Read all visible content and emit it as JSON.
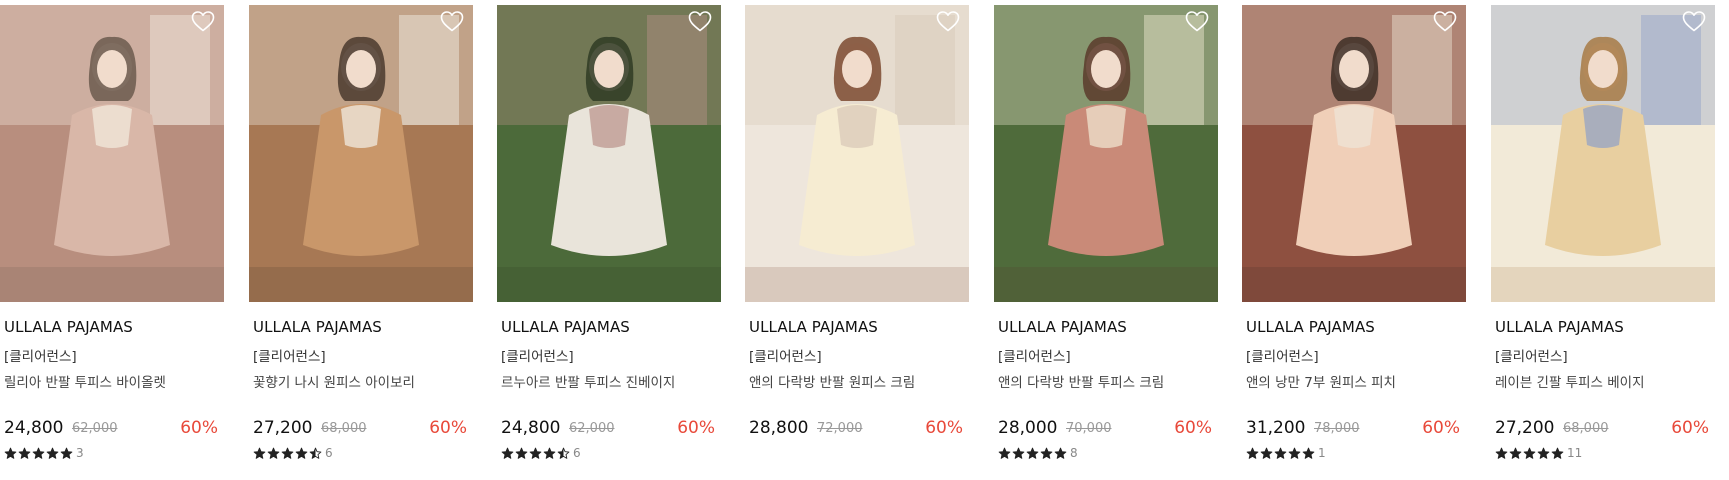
{
  "products": [
    {
      "brand": "ULLALA PAJAMAS",
      "tag": "[클리어런스]",
      "name": "릴리아 반팔 투피스 바이올렛",
      "price": "24,800",
      "original_price": "62,000",
      "discount": "60%",
      "rating": 5,
      "review_count": "3",
      "palette": [
        "#b88e7e",
        "#d9b7a8",
        "#f4ece0",
        "#6b5a4e"
      ]
    },
    {
      "brand": "ULLALA PAJAMAS",
      "tag": "[클리어런스]",
      "name": "꽃향기 나시 원피스 아이보리",
      "price": "27,200",
      "original_price": "68,000",
      "discount": "60%",
      "rating": 4.5,
      "review_count": "6",
      "palette": [
        "#a77854",
        "#c9976a",
        "#f4f1ea",
        "#4a3a2e"
      ]
    },
    {
      "brand": "ULLALA PAJAMAS",
      "tag": "[클리어런스]",
      "name": "르누아르 반팔 투피스 진베이지",
      "price": "24,800",
      "original_price": "62,000",
      "discount": "60%",
      "rating": 4.5,
      "review_count": "6",
      "palette": [
        "#4c6a3a",
        "#e9e4da",
        "#b9918a",
        "#2f3b24"
      ]
    },
    {
      "brand": "ULLALA PAJAMAS",
      "tag": "[클리어런스]",
      "name": "앤의 다락방 반팔 원피스 크림",
      "price": "28,800",
      "original_price": "72,000",
      "discount": "60%",
      "rating": 0,
      "review_count": "",
      "palette": [
        "#eee6dc",
        "#f6ecd2",
        "#d8c8b6",
        "#7b4a30"
      ]
    },
    {
      "brand": "ULLALA PAJAMAS",
      "tag": "[클리어런스]",
      "name": "앤의 다락방 반팔 투피스 크림",
      "price": "28,000",
      "original_price": "70,000",
      "discount": "60%",
      "rating": 5,
      "review_count": "8",
      "palette": [
        "#4f6b3b",
        "#c98a78",
        "#f2ead4",
        "#5a3a2a"
      ]
    },
    {
      "brand": "ULLALA PAJAMAS",
      "tag": "[클리어런스]",
      "name": "앤의 낭만 7부 원피스 피치",
      "price": "31,200",
      "original_price": "78,000",
      "discount": "60%",
      "rating": 5,
      "review_count": "1",
      "palette": [
        "#8e5040",
        "#f0cfb8",
        "#eee6d8",
        "#3d2e26"
      ]
    },
    {
      "brand": "ULLALA PAJAMAS",
      "tag": "[클리어런스]",
      "name": "레이븐 긴팔 투피스 베이지",
      "price": "27,200",
      "original_price": "68,000",
      "discount": "60%",
      "rating": 5,
      "review_count": "11",
      "palette": [
        "#f2ead8",
        "#e8cfa0",
        "#8ea0c8",
        "#a77a45"
      ]
    }
  ],
  "icons": {
    "wishlist": "heart-outline-icon",
    "rating": "star-icon"
  },
  "colors": {
    "discount": "#e8493a",
    "star": "#222222",
    "original_price": "#999999"
  }
}
